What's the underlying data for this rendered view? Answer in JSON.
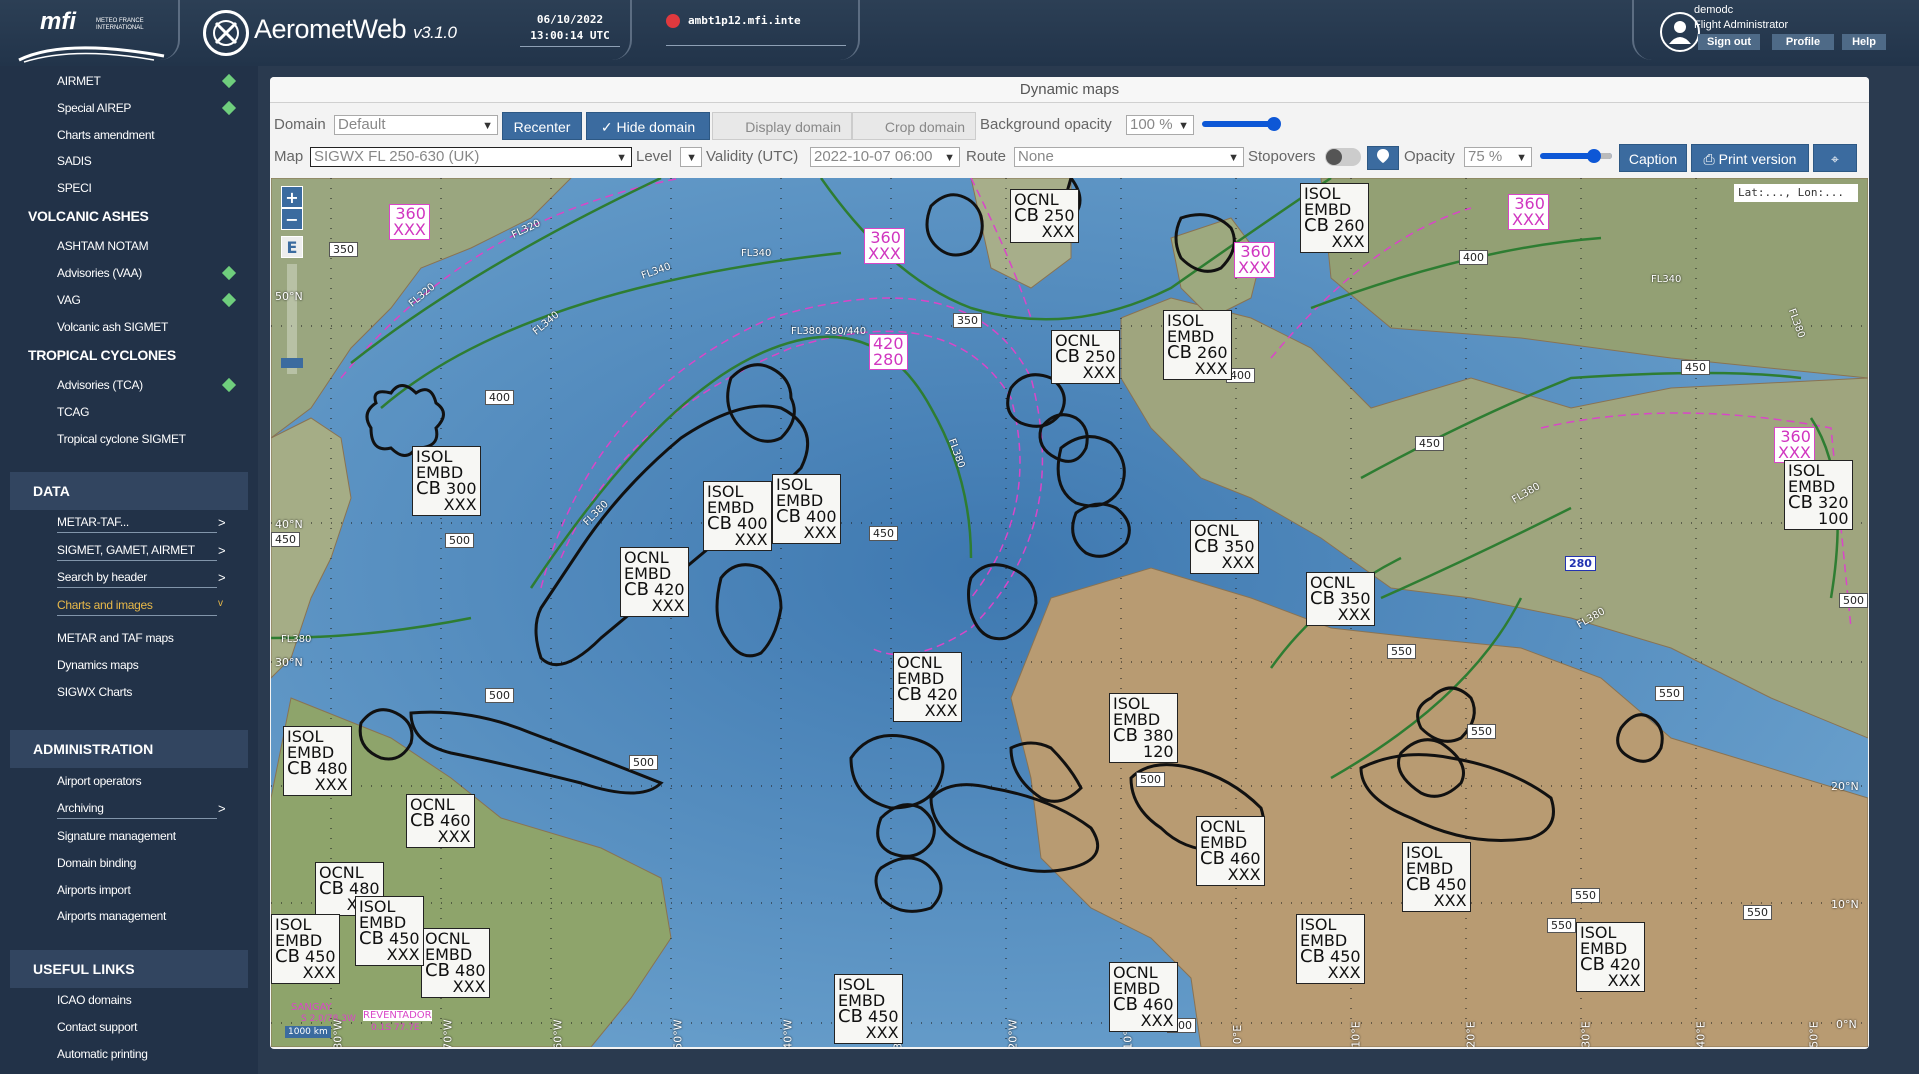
{
  "header": {
    "logo_text": "mfi",
    "logo_sub": "METEO FRANCE INTERNATIONAL",
    "app_name": "AerometWeb",
    "app_version": "v3.1.0",
    "date": "06/10/2022",
    "time": "13:00:14 UTC",
    "server": "ambt1p12.mfi.inte",
    "user_name": "demodc",
    "user_role": "Flight Administrator",
    "sign_out": "Sign out",
    "profile": "Profile",
    "help": "Help"
  },
  "sidebar": {
    "top_items": [
      {
        "label": "AIRMET",
        "badge": true
      },
      {
        "label": "Special AIREP",
        "badge": true
      },
      {
        "label": "Charts amendment",
        "badge": false
      },
      {
        "label": "SADIS",
        "badge": false
      },
      {
        "label": "SPECI",
        "badge": false
      }
    ],
    "volcanic_title": "VOLCANIC ASHES",
    "volcanic_items": [
      {
        "label": "ASHTAM NOTAM",
        "badge": false
      },
      {
        "label": "Advisories (VAA)",
        "badge": true
      },
      {
        "label": "VAG",
        "badge": true
      },
      {
        "label": "Volcanic ash SIGMET",
        "badge": false
      }
    ],
    "tropical_title": "TROPICAL CYCLONES",
    "tropical_items": [
      {
        "label": "Advisories (TCA)",
        "badge": true
      },
      {
        "label": "TCAG",
        "badge": false
      },
      {
        "label": "Tropical cyclone SIGMET",
        "badge": false
      }
    ],
    "data_header": "DATA",
    "data_items": [
      {
        "label": "METAR-TAF...",
        "chevron": ">"
      },
      {
        "label": "SIGMET, GAMET, AIRMET",
        "chevron": ">"
      },
      {
        "label": "Search by header",
        "chevron": ">"
      },
      {
        "label": "Charts and images",
        "chevron": "v",
        "active": true
      },
      {
        "label": "METAR and TAF maps"
      },
      {
        "label": "Dynamics maps"
      },
      {
        "label": "SIGWX Charts"
      }
    ],
    "admin_header": "ADMINISTRATION",
    "admin_items": [
      {
        "label": "Airport operators"
      },
      {
        "label": "Archiving",
        "chevron": ">"
      },
      {
        "label": "Signature management"
      },
      {
        "label": "Domain binding"
      },
      {
        "label": "Airports import"
      },
      {
        "label": "Airports management"
      }
    ],
    "links_header": "USEFUL LINKS",
    "links_items": [
      {
        "label": "ICAO domains"
      },
      {
        "label": "Contact support"
      },
      {
        "label": "Automatic printing"
      }
    ]
  },
  "panel": {
    "title": "Dynamic maps",
    "domain_label": "Domain",
    "domain_value": "Default",
    "recenter": "Recenter",
    "hide_domain": "Hide domain",
    "display_domain": "Display domain",
    "crop_domain": "Crop domain",
    "bg_opacity_label": "Background opacity",
    "bg_opacity_value": "100 %",
    "bg_opacity_level": 1.0,
    "map_label": "Map",
    "map_value": "SIGWX FL 250-630 (UK)",
    "level_label": "Level",
    "level_value": "",
    "validity_label": "Validity (UTC)",
    "validity_value": "2022-10-07 06:00",
    "route_label": "Route",
    "route_value": "None",
    "stopovers_label": "Stopovers",
    "stopovers_on": false,
    "opacity_label": "Opacity",
    "opacity_value": "75 %",
    "opacity_level": 0.75,
    "caption": "Caption",
    "print_version": "Print version"
  },
  "map": {
    "zoom_in": "+",
    "zoom_out": "−",
    "edit": "E",
    "latlon": "Lat:..., Lon:...",
    "scale": "1000 km",
    "volcano_1": "SANGAY",
    "volcano_1_coord": "S 2.0/78.3W",
    "volcano_2": "REVENTADOR",
    "volcano_2_coord": "0.1S 77.7E",
    "lat_labels": [
      "50°N",
      "40°N",
      "30°N",
      "20°N",
      "10°N",
      "0°N"
    ],
    "lon_labels": [
      "80°W",
      "70°W",
      "60°W",
      "50°W",
      "40°W",
      "30°W",
      "20°W",
      "10°W",
      "0°E",
      "10°E",
      "20°E",
      "30°E",
      "40°E",
      "50°E"
    ],
    "jet_labels": [
      "FL320",
      "FL340",
      "FL320",
      "FL340",
      "FL340",
      "FL380 280/440",
      "FL380",
      "FL380",
      "FL340",
      "FL380",
      "FL380",
      "FL380",
      "FL380"
    ],
    "tropopause": [
      "350",
      "400",
      "450",
      "500",
      "500",
      "500",
      "450",
      "350",
      "400",
      "400",
      "450",
      "450",
      "500",
      "550",
      "550",
      "550",
      "500",
      "550",
      "550",
      "550",
      "500",
      "280"
    ],
    "cb_areas": [
      {
        "l1": "OCNL",
        "l2": "",
        "top": "250",
        "base": "XXX"
      },
      {
        "l1": "ISOL",
        "l2": "EMBD",
        "top": "260",
        "base": "XXX"
      },
      {
        "l1": "OCNL",
        "l2": "",
        "top": "250",
        "base": "XXX"
      },
      {
        "l1": "ISOL",
        "l2": "EMBD",
        "top": "260",
        "base": "XXX"
      },
      {
        "l1": "ISOL",
        "l2": "EMBD",
        "top": "300",
        "base": "XXX"
      },
      {
        "l1": "ISOL",
        "l2": "EMBD",
        "top": "400",
        "base": "XXX"
      },
      {
        "l1": "ISOL",
        "l2": "EMBD",
        "top": "400",
        "base": "XXX"
      },
      {
        "l1": "OCNL",
        "l2": "EMBD",
        "top": "420",
        "base": "XXX"
      },
      {
        "l1": "OCNL",
        "l2": "",
        "top": "350",
        "base": "XXX"
      },
      {
        "l1": "OCNL",
        "l2": "",
        "top": "350",
        "base": "XXX"
      },
      {
        "l1": "ISOL",
        "l2": "EMBD",
        "top": "320",
        "base": "100"
      },
      {
        "l1": "OCNL",
        "l2": "EMBD",
        "top": "420",
        "base": "XXX"
      },
      {
        "l1": "ISOL",
        "l2": "EMBD",
        "top": "380",
        "base": "120"
      },
      {
        "l1": "ISOL",
        "l2": "EMBD",
        "top": "480",
        "base": "XXX"
      },
      {
        "l1": "OCNL",
        "l2": "",
        "top": "460",
        "base": "XXX"
      },
      {
        "l1": "OCNL",
        "l2": "",
        "top": "480",
        "base": "XXX"
      },
      {
        "l1": "ISOL",
        "l2": "EMBD",
        "top": "450",
        "base": "XXX"
      },
      {
        "l1": "OCNL",
        "l2": "EMBD",
        "top": "480",
        "base": "XXX"
      },
      {
        "l1": "ISOL",
        "l2": "EMBD",
        "top": "450",
        "base": "XXX"
      },
      {
        "l1": "OCNL",
        "l2": "EMBD",
        "top": "460",
        "base": "XXX"
      },
      {
        "l1": "ISOL",
        "l2": "EMBD",
        "top": "450",
        "base": "XXX"
      },
      {
        "l1": "ISOL",
        "l2": "EMBD",
        "top": "450",
        "base": "XXX"
      },
      {
        "l1": "OCNL",
        "l2": "EMBD",
        "top": "460",
        "base": "XXX"
      },
      {
        "l1": "ISOL",
        "l2": "EMBD",
        "top": "420",
        "base": "XXX"
      },
      {
        "l1": "ISOL",
        "l2": "EMBD",
        "top": "450",
        "base": "XXX"
      }
    ],
    "turb_boxes": [
      {
        "top": "360",
        "base": "XXX"
      },
      {
        "top": "360",
        "base": "XXX"
      },
      {
        "top": "360",
        "base": "XXX"
      },
      {
        "top": "360",
        "base": "XXX"
      },
      {
        "top": "420",
        "base": "280"
      },
      {
        "top": "360",
        "base": "XXX"
      }
    ],
    "colors": {
      "sea": "#4f86b9",
      "land": "#b89b72",
      "jet": "#2e7d32",
      "turb": "#d946c8",
      "cb": "#111111"
    }
  }
}
